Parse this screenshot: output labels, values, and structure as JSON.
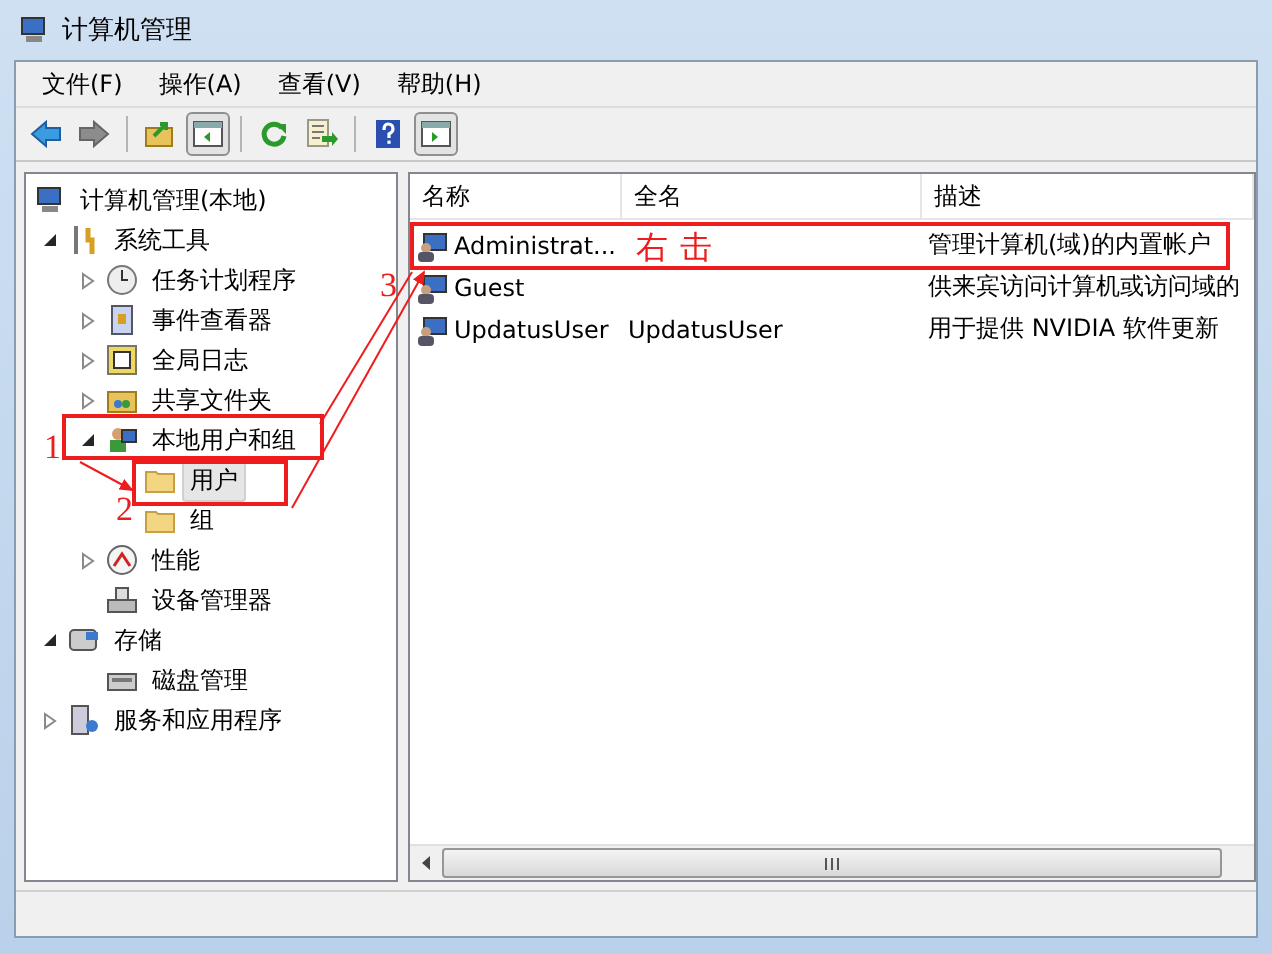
{
  "window": {
    "title": "计算机管理"
  },
  "menu": [
    "文件(F)",
    "操作(A)",
    "查看(V)",
    "帮助(H)"
  ],
  "toolbar": [
    {
      "pressed": false
    },
    {
      "pressed": false
    },
    {
      "pressed": false
    },
    {
      "pressed": true
    },
    {
      "pressed": false
    },
    {
      "pressed": false
    },
    {
      "pressed": false
    },
    {
      "pressed": true
    }
  ],
  "tree": [
    {
      "label": "计算机管理(本地)",
      "selected": false,
      "children": [
        {
          "label": "系统工具",
          "expanded": true,
          "selected": false,
          "children": [
            {
              "label": "任务计划程序",
              "expanded": false,
              "selected": false
            },
            {
              "label": "事件查看器",
              "expanded": false,
              "selected": false
            },
            {
              "label": "全局日志",
              "expanded": false,
              "selected": false
            },
            {
              "label": "共享文件夹",
              "expanded": false,
              "selected": false
            },
            {
              "label": "本地用户和组",
              "expanded": true,
              "selected": false,
              "children": [
                {
                  "label": "用户",
                  "selected": true
                },
                {
                  "label": "组",
                  "selected": false
                }
              ]
            },
            {
              "label": "性能",
              "expanded": false,
              "selected": false
            },
            {
              "label": "设备管理器",
              "selected": false
            }
          ]
        },
        {
          "label": "存储",
          "expanded": true,
          "selected": false,
          "children": [
            {
              "label": "磁盘管理",
              "selected": false
            }
          ]
        },
        {
          "label": "服务和应用程序",
          "expanded": false,
          "selected": false
        }
      ]
    }
  ],
  "table": {
    "columns": [
      "名称",
      "全名",
      "描述"
    ],
    "rows": [
      {
        "cells": [
          "Administrat...",
          "",
          "管理计算机(域)的内置帐户"
        ]
      },
      {
        "cells": [
          "Guest",
          "",
          "供来宾访问计算机或访问域的"
        ]
      },
      {
        "cells": [
          "UpdatusUser",
          "UpdatusUser",
          "用于提供 NVIDIA 软件更新"
        ]
      }
    ]
  },
  "annotations": {
    "numbers": [
      "1",
      "2",
      "3"
    ],
    "note": "右击"
  }
}
